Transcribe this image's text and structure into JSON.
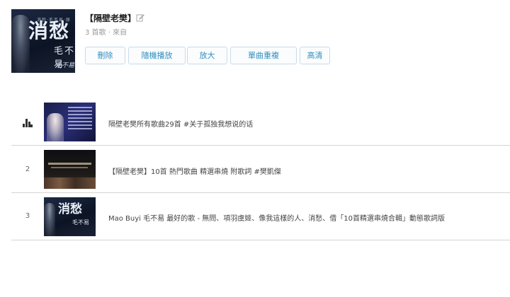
{
  "playlist": {
    "title": "【隔壁老樊】",
    "meta": "3 首歌 · 來自",
    "edit_icon": "edit-icon"
  },
  "cover": {
    "big_title": "消愁",
    "small_title": "毛不易",
    "tiny_line": "消愁·毛不易·原唱",
    "signature": "毛不易"
  },
  "buttons": [
    {
      "label": "刪除"
    },
    {
      "label": "隨機播放"
    },
    {
      "label": "放大"
    },
    {
      "label": "單曲重複"
    },
    {
      "label": "高清"
    }
  ],
  "tracks": [
    {
      "number": "",
      "playing": true,
      "icon": "playing-bars-icon",
      "title": "隔壁老樊所有歌曲29首 #关于孤独我想说的话"
    },
    {
      "number": "2",
      "playing": false,
      "title": "【隔壁老樊】10首 熱門歌曲 精選串燒 附歌詞 #樊凱傑"
    },
    {
      "number": "3",
      "playing": false,
      "title": "Mao Buyi 毛不易 最好的歌 - 無問、項羽虞姬、像我這樣的人、消愁、借「10首精選串燒合輯」動態歌詞版"
    }
  ],
  "colors": {
    "accent": "#2f8fc0",
    "button_border": "#c9dbe8",
    "divider": "#d5d5d5"
  }
}
